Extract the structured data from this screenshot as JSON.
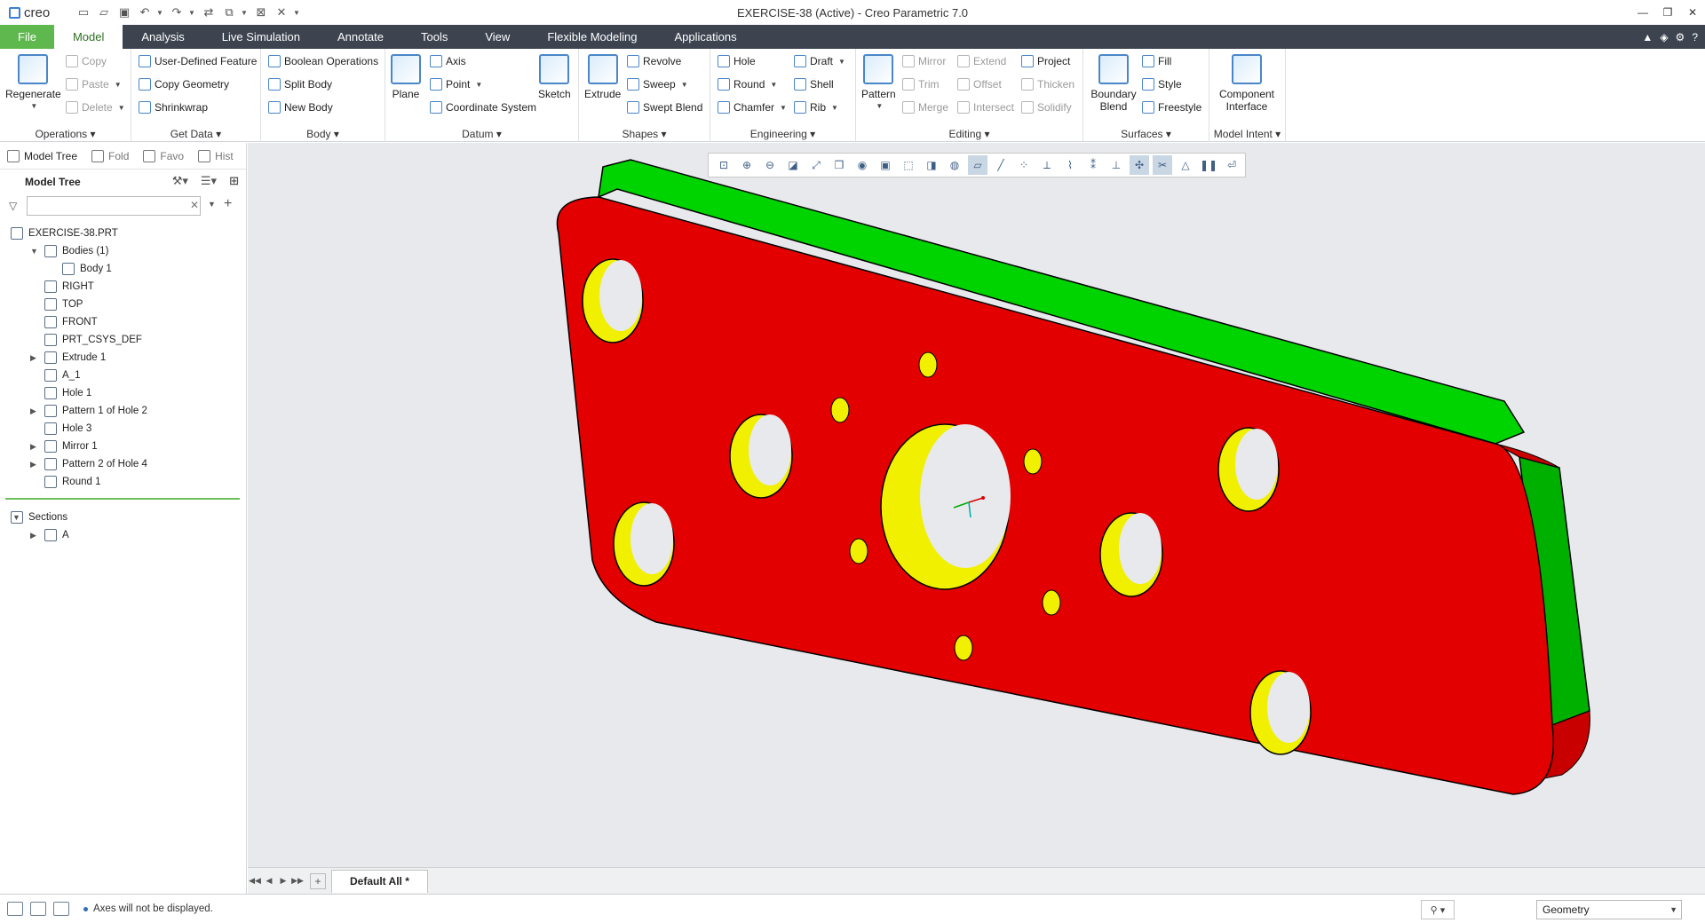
{
  "app": {
    "logo_text": "creo",
    "window_title": "EXERCISE-38 (Active) - Creo Parametric 7.0"
  },
  "tabs": [
    "File",
    "Model",
    "Analysis",
    "Live Simulation",
    "Annotate",
    "Tools",
    "View",
    "Flexible Modeling",
    "Applications"
  ],
  "ribbon": {
    "operations": {
      "label": "Operations",
      "regenerate": "Regenerate",
      "copy": "Copy",
      "paste": "Paste",
      "delete": "Delete"
    },
    "get_data": {
      "label": "Get Data",
      "udf": "User-Defined Feature",
      "copy_geometry": "Copy Geometry",
      "shrinkwrap": "Shrinkwrap"
    },
    "body": {
      "label": "Body",
      "boolean": "Boolean Operations",
      "split": "Split Body",
      "new": "New Body"
    },
    "datum": {
      "label": "Datum",
      "plane": "Plane",
      "axis": "Axis",
      "point": "Point",
      "csys": "Coordinate System",
      "sketch": "Sketch"
    },
    "shapes": {
      "label": "Shapes",
      "extrude": "Extrude",
      "revolve": "Revolve",
      "sweep": "Sweep",
      "swept_blend": "Swept Blend"
    },
    "engineering": {
      "label": "Engineering",
      "hole": "Hole",
      "round": "Round",
      "chamfer": "Chamfer",
      "draft": "Draft",
      "shell": "Shell",
      "rib": "Rib"
    },
    "editing": {
      "label": "Editing",
      "pattern": "Pattern",
      "mirror": "Mirror",
      "trim": "Trim",
      "merge": "Merge",
      "extend": "Extend",
      "offset": "Offset",
      "intersect": "Intersect",
      "project": "Project",
      "thicken": "Thicken",
      "solidify": "Solidify"
    },
    "surfaces": {
      "label": "Surfaces",
      "boundary_blend": "Boundary Blend",
      "fill": "Fill",
      "style": "Style",
      "freestyle": "Freestyle"
    },
    "model_intent": {
      "label": "Model Intent",
      "component_interface": "Component Interface"
    }
  },
  "left_panel": {
    "tabs": [
      "Model Tree",
      "Fold",
      "Favo",
      "Hist"
    ],
    "header": "Model Tree",
    "search_value": "",
    "tree": [
      {
        "label": "EXERCISE-38.PRT",
        "level": 0,
        "expander": "",
        "icon": "part-icon"
      },
      {
        "label": "Bodies (1)",
        "level": 1,
        "expander": "open",
        "icon": "bodies-icon"
      },
      {
        "label": "Body 1",
        "level": 2,
        "expander": "",
        "icon": "body-icon"
      },
      {
        "label": "RIGHT",
        "level": 1,
        "expander": "",
        "icon": "datum-plane-icon"
      },
      {
        "label": "TOP",
        "level": 1,
        "expander": "",
        "icon": "datum-plane-icon"
      },
      {
        "label": "FRONT",
        "level": 1,
        "expander": "",
        "icon": "datum-plane-icon"
      },
      {
        "label": "PRT_CSYS_DEF",
        "level": 1,
        "expander": "",
        "icon": "csys-icon"
      },
      {
        "label": "Extrude 1",
        "level": 1,
        "expander": "closed",
        "icon": "extrude-icon"
      },
      {
        "label": "A_1",
        "level": 1,
        "expander": "",
        "icon": "axis-icon"
      },
      {
        "label": "Hole 1",
        "level": 1,
        "expander": "",
        "icon": "hole-icon"
      },
      {
        "label": "Pattern 1 of Hole 2",
        "level": 1,
        "expander": "closed",
        "icon": "pattern-icon"
      },
      {
        "label": "Hole 3",
        "level": 1,
        "expander": "",
        "icon": "hole-icon"
      },
      {
        "label": "Mirror 1",
        "level": 1,
        "expander": "closed",
        "icon": "mirror-icon"
      },
      {
        "label": "Pattern 2 of Hole 4",
        "level": 1,
        "expander": "closed",
        "icon": "pattern-icon"
      },
      {
        "label": "Round 1",
        "level": 1,
        "expander": "",
        "icon": "round-icon"
      }
    ],
    "sections": [
      {
        "label": "Sections",
        "level": 0,
        "expander": "open",
        "icon": "sections-icon"
      },
      {
        "label": "A",
        "level": 1,
        "expander": "closed",
        "icon": "section-icon"
      }
    ]
  },
  "bottom_tab": "Default All *",
  "status": {
    "message": "Axes will not be displayed.",
    "filter": "Geometry"
  },
  "colors": {
    "tab_bar": "#3d4450",
    "file_tab": "#5fb84e",
    "part_face": "#e30000",
    "part_side_green": "#00d400",
    "hole_yellow": "#f0f000",
    "viewport_bg": "#e8e9ec"
  }
}
